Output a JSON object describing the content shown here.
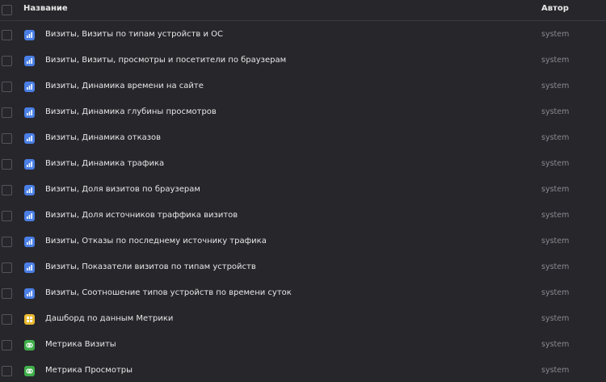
{
  "header": {
    "name_label": "Название",
    "author_label": "Автор"
  },
  "rows": [
    {
      "title": "Визиты, Визиты по типам устройств и ОС",
      "author": "system",
      "icon": "chart-icon",
      "color": "#4a7fe5"
    },
    {
      "title": "Визиты, Визиты, просмотры и посетители по браузерам",
      "author": "system",
      "icon": "chart-icon",
      "color": "#4a7fe5"
    },
    {
      "title": "Визиты, Динамика времени на сайте",
      "author": "system",
      "icon": "chart-icon",
      "color": "#4a7fe5"
    },
    {
      "title": "Визиты, Динамика глубины просмотров",
      "author": "system",
      "icon": "chart-icon",
      "color": "#4a7fe5"
    },
    {
      "title": "Визиты, Динамика отказов",
      "author": "system",
      "icon": "chart-icon",
      "color": "#4a7fe5"
    },
    {
      "title": "Визиты, Динамика трафика",
      "author": "system",
      "icon": "chart-icon",
      "color": "#4a7fe5"
    },
    {
      "title": "Визиты, Доля визитов по браузерам",
      "author": "system",
      "icon": "chart-icon",
      "color": "#4a7fe5"
    },
    {
      "title": "Визиты, Доля источников траффика визитов",
      "author": "system",
      "icon": "chart-icon",
      "color": "#4a7fe5"
    },
    {
      "title": "Визиты, Отказы по последнему источнику трафика",
      "author": "system",
      "icon": "chart-icon",
      "color": "#4a7fe5"
    },
    {
      "title": "Визиты, Показатели визитов по типам устройств",
      "author": "system",
      "icon": "chart-icon",
      "color": "#4a7fe5"
    },
    {
      "title": "Визиты, Соотношение типов устройств по времени суток",
      "author": "system",
      "icon": "chart-icon",
      "color": "#4a7fe5"
    },
    {
      "title": "Дашборд по данным Метрики",
      "author": "system",
      "icon": "dashboard-icon",
      "color": "#e9b92f"
    },
    {
      "title": "Метрика Визиты",
      "author": "system",
      "icon": "dataset-icon",
      "color": "#3fae4a"
    },
    {
      "title": "Метрика Просмотры",
      "author": "system",
      "icon": "dataset-icon",
      "color": "#3fae4a"
    }
  ]
}
